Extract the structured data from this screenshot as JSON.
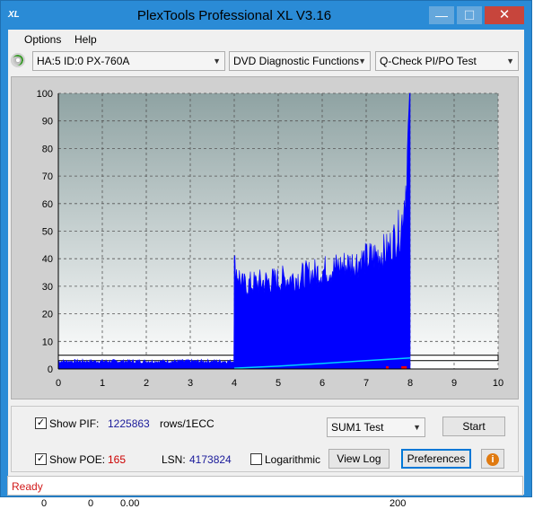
{
  "window": {
    "title": "PlexTools Professional XL V3.16",
    "app_icon_text": "XL",
    "controls": {
      "minimize": "—",
      "maximize": "☐",
      "close": "✕"
    }
  },
  "menubar": {
    "options": "Options",
    "help": "Help"
  },
  "toolbar": {
    "drive_select": "HA:5 ID:0  PX-760A",
    "function_select": "DVD Diagnostic Functions",
    "test_select": "Q-Check PI/PO Test",
    "drive_icon": "disc-icon"
  },
  "chart_data": {
    "type": "area",
    "x_ticks": [
      "0",
      "1",
      "2",
      "3",
      "4",
      "5",
      "6",
      "7",
      "8",
      "9",
      "10"
    ],
    "y_ticks": [
      "0",
      "10",
      "20",
      "30",
      "40",
      "50",
      "60",
      "70",
      "80",
      "90",
      "100"
    ],
    "xlim": [
      0,
      10
    ],
    "ylim": [
      0,
      100
    ],
    "grid": true,
    "threshold_line": 4,
    "series": [
      {
        "color": "#0000ff",
        "points": [
          [
            0,
            2
          ],
          [
            0.5,
            2
          ],
          [
            1,
            2
          ],
          [
            1.5,
            2
          ],
          [
            2,
            2
          ],
          [
            2.5,
            2
          ],
          [
            3,
            2
          ],
          [
            3.5,
            2
          ],
          [
            3.99,
            2
          ],
          [
            4.0,
            35
          ],
          [
            4.2,
            28
          ],
          [
            4.5,
            29
          ],
          [
            5.0,
            30
          ],
          [
            5.5,
            31
          ],
          [
            6.0,
            33
          ],
          [
            6.5,
            35
          ],
          [
            7.0,
            37
          ],
          [
            7.5,
            40
          ],
          [
            7.8,
            48
          ],
          [
            7.9,
            62
          ],
          [
            7.97,
            82
          ],
          [
            8.0,
            100
          ]
        ]
      },
      {
        "color": "#00d0ff",
        "points": [
          [
            4.0,
            0.3
          ],
          [
            5.0,
            1.0
          ],
          [
            6.0,
            2.0
          ],
          [
            7.0,
            3.0
          ],
          [
            8.0,
            4.0
          ]
        ]
      }
    ]
  },
  "panel": {
    "show_pif_label": "Show PIF:",
    "pif_value": "1225863",
    "pif_unit": "rows/1ECC",
    "show_poe_label": "Show POE:",
    "poe_value": "165",
    "lsn_label": "LSN:",
    "lsn_value": "4173824",
    "logarithmic_label": "Logarithmic",
    "test_mode_select": "SUM1 Test",
    "start_button": "Start",
    "view_log_button": "View Log",
    "preferences_button": "Preferences",
    "info_icon": "info-icon",
    "show_pif_checked": true,
    "show_poe_checked": true,
    "logarithmic_checked": false
  },
  "status": {
    "text": "Ready"
  },
  "underlap": {
    "a": "0",
    "b": "0",
    "c": "0.00",
    "d": "200"
  }
}
